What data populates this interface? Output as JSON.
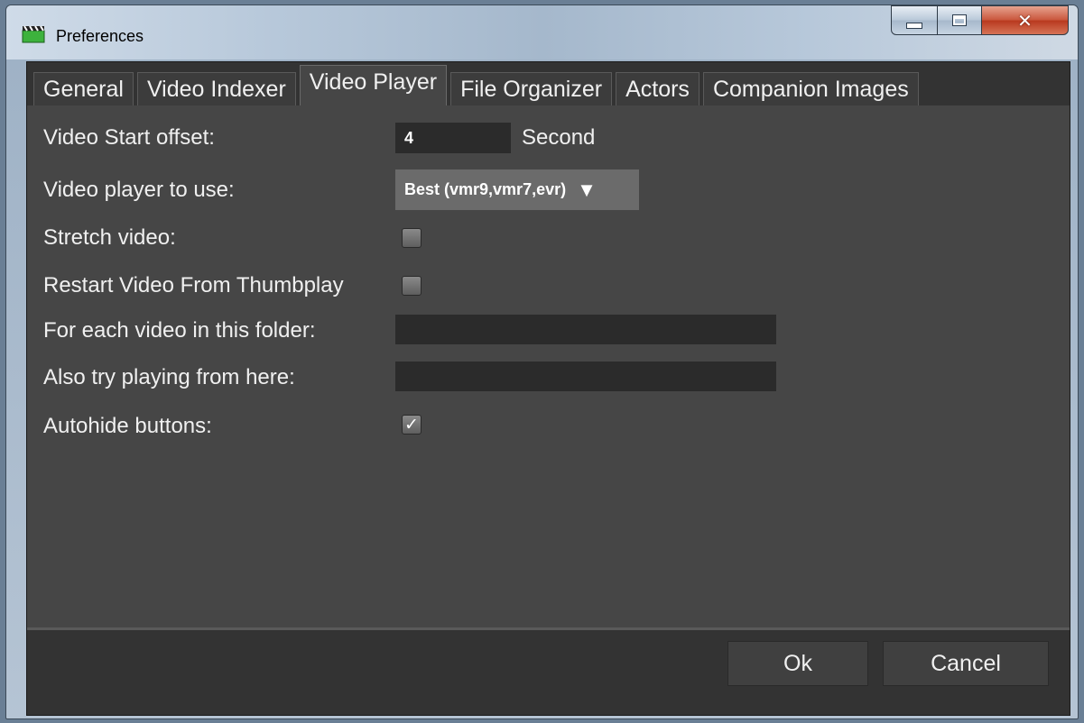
{
  "window": {
    "title": "Preferences"
  },
  "tabs": [
    {
      "label": "General"
    },
    {
      "label": "Video Indexer"
    },
    {
      "label": "Video Player",
      "active": true
    },
    {
      "label": "File Organizer"
    },
    {
      "label": "Actors"
    },
    {
      "label": "Companion Images"
    }
  ],
  "settings": {
    "start_offset": {
      "label": "Video Start offset:",
      "value": "4",
      "unit": "Second"
    },
    "player": {
      "label": "Video player to use:",
      "selected": "Best (vmr9,vmr7,evr)"
    },
    "stretch": {
      "label": "Stretch video:",
      "checked": false
    },
    "restart": {
      "label": "Restart Video From Thumbplay",
      "checked": false
    },
    "folder_action": {
      "label": "For each video in this folder:",
      "value": ""
    },
    "alt_path": {
      "label": "Also try playing from here:",
      "value": ""
    },
    "autohide": {
      "label": "Autohide buttons:",
      "checked": true,
      "mark": "✓"
    }
  },
  "buttons": {
    "ok": "Ok",
    "cancel": "Cancel"
  },
  "colors": {
    "panel": "#464646",
    "field": "#2b2b2b",
    "close": "#c9553b"
  }
}
